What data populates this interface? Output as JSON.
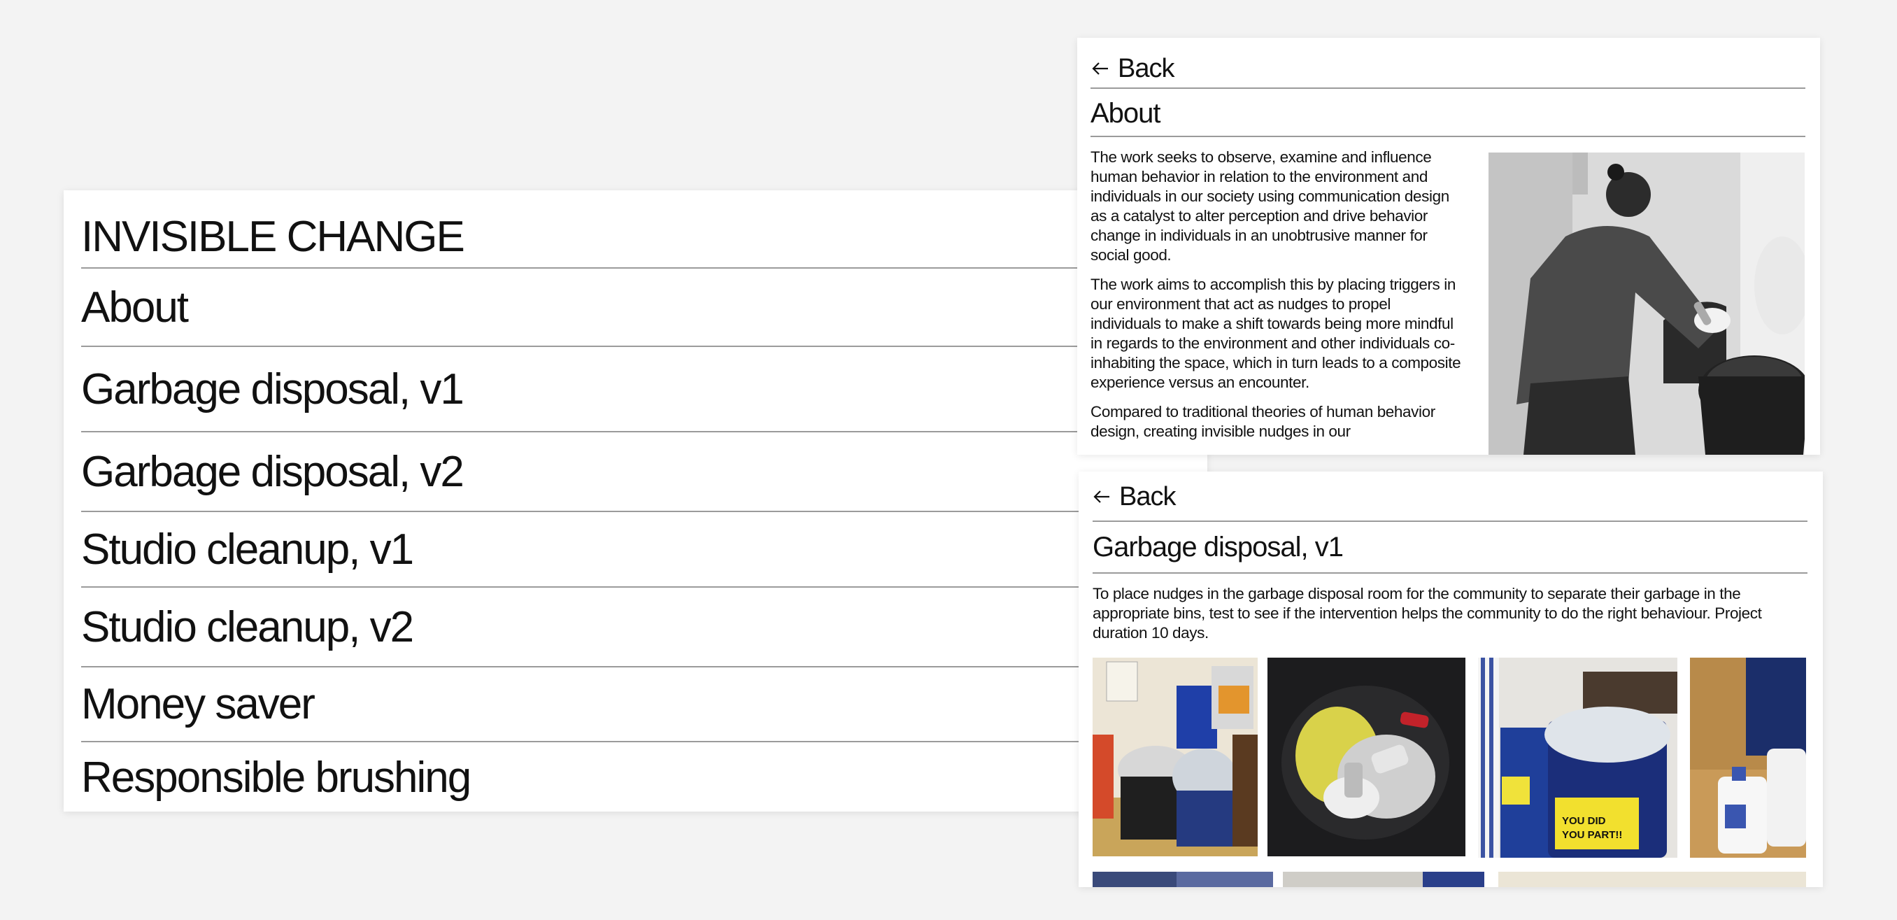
{
  "menu": {
    "title": "INVISIBLE CHANGE",
    "items": [
      {
        "label": "About"
      },
      {
        "label": "Garbage disposal, v1"
      },
      {
        "label": "Garbage disposal, v2"
      },
      {
        "label": "Studio cleanup, v1"
      },
      {
        "label": "Studio cleanup, v2"
      },
      {
        "label": "Money saver"
      },
      {
        "label": "Responsible brushing"
      }
    ]
  },
  "about_panel": {
    "back_label": "Back",
    "heading": "About",
    "paragraphs": [
      "The work seeks to observe, examine and influence human behavior in relation to the environment and individuals in our society using communication design as a catalyst to alter perception and drive behavior change in individuals in an unobtrusive manner for social good.",
      "The work aims to accomplish this by placing triggers in our environment that act as nudges to propel individuals to make a shift towards being more mindful in regards to the environment and other individuals co-inhabiting the space, which in turn leads to a composite experience versus an encounter.",
      "Compared to traditional theories of human behavior design, creating invisible nudges in our"
    ]
  },
  "garbage_panel": {
    "back_label": "Back",
    "heading": "Garbage disposal, v1",
    "description": "To place nudges in the garbage disposal room for the community to separate their garbage in the appropriate bins, test to see if the intervention helps the community to do the right behaviour. Project duration 10 days.",
    "sign_text_1": "YOU DID",
    "sign_text_2": "YOU PART!!"
  }
}
